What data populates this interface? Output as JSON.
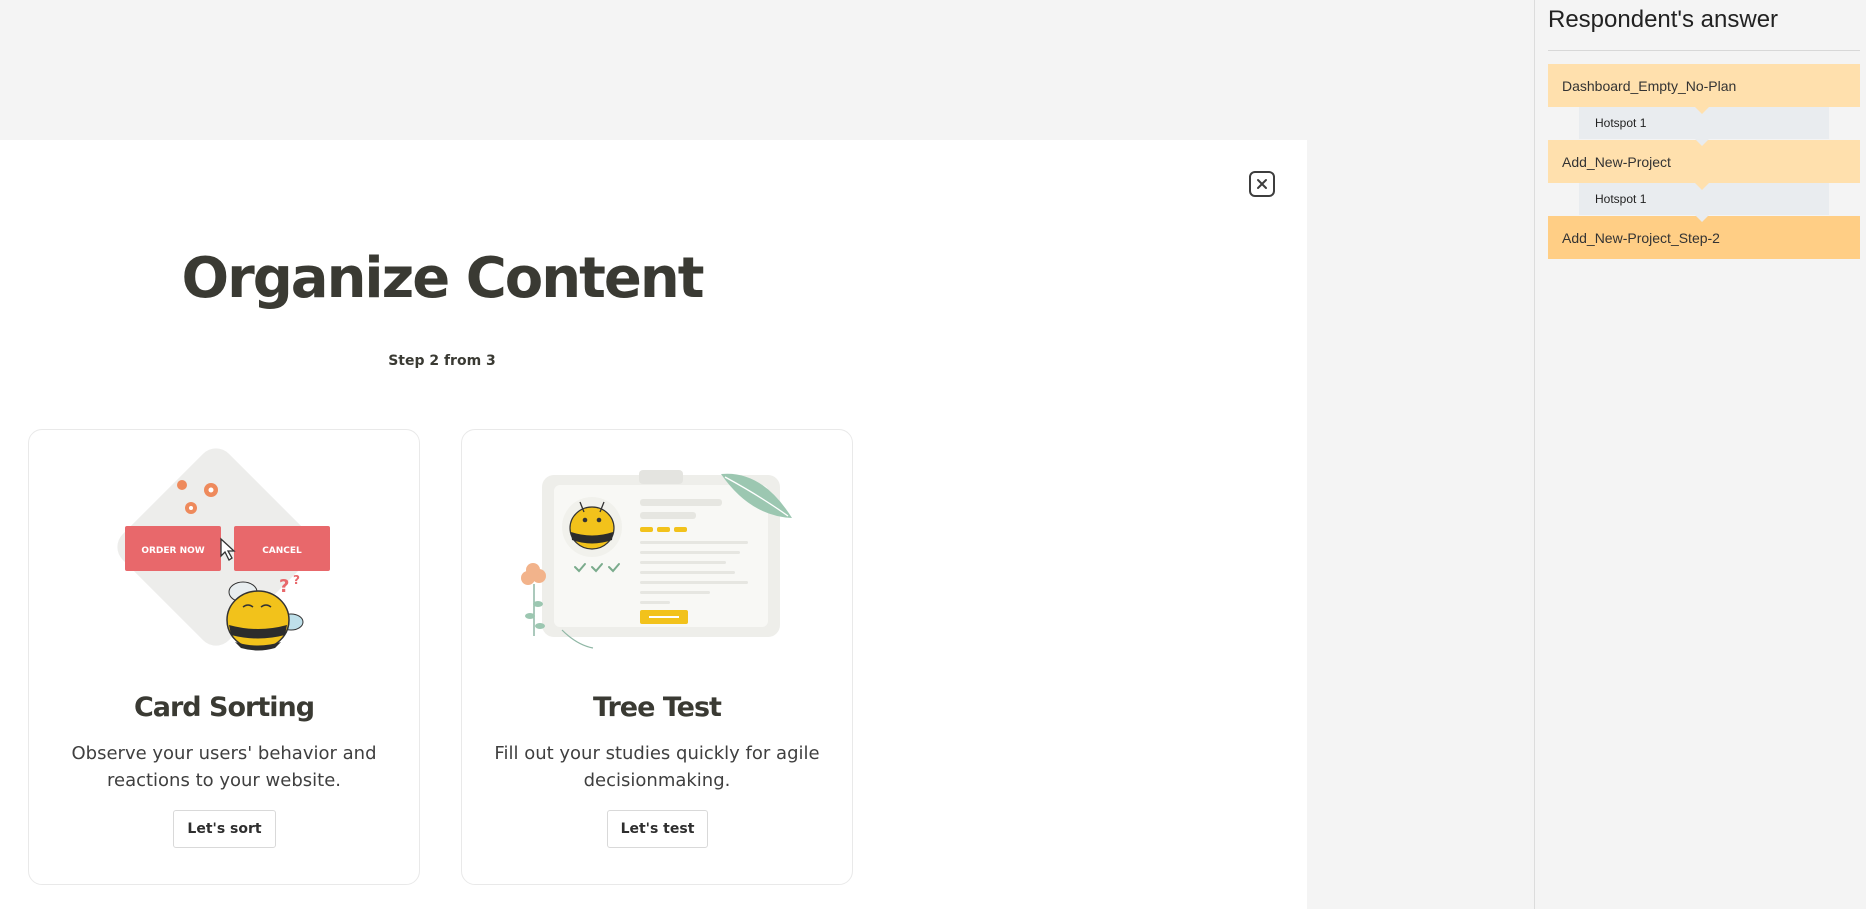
{
  "modal": {
    "title": "Organize Content",
    "step": "Step 2 from 3",
    "cards": [
      {
        "title": "Card Sorting",
        "description": "Observe your users' behavior and reactions to your website.",
        "button": "Let's sort",
        "illustration": {
          "order_label": "ORDER NOW",
          "cancel_label": "CANCEL",
          "question_mark": "?",
          "button_color": "#e8686b"
        }
      },
      {
        "title": "Tree Test",
        "description": "Fill out your studies quickly for agile decisionmaking.",
        "button": "Let's test"
      }
    ]
  },
  "panel": {
    "title": "Respondent's answer",
    "path": [
      {
        "type": "screen",
        "label": "Dashboard_Empty_No-Plan"
      },
      {
        "type": "hotspot",
        "label": "Hotspot 1"
      },
      {
        "type": "screen",
        "label": "Add_New-Project"
      },
      {
        "type": "hotspot",
        "label": "Hotspot 1"
      },
      {
        "type": "screen",
        "label": "Add_New-Project_Step-2",
        "current": true
      }
    ]
  },
  "colors": {
    "screen": "#ffe0ad",
    "screen_current": "#ffce85",
    "hotspot": "#e9ecef",
    "heading": "#3a3a33",
    "bee_yellow": "#f2c21b"
  }
}
